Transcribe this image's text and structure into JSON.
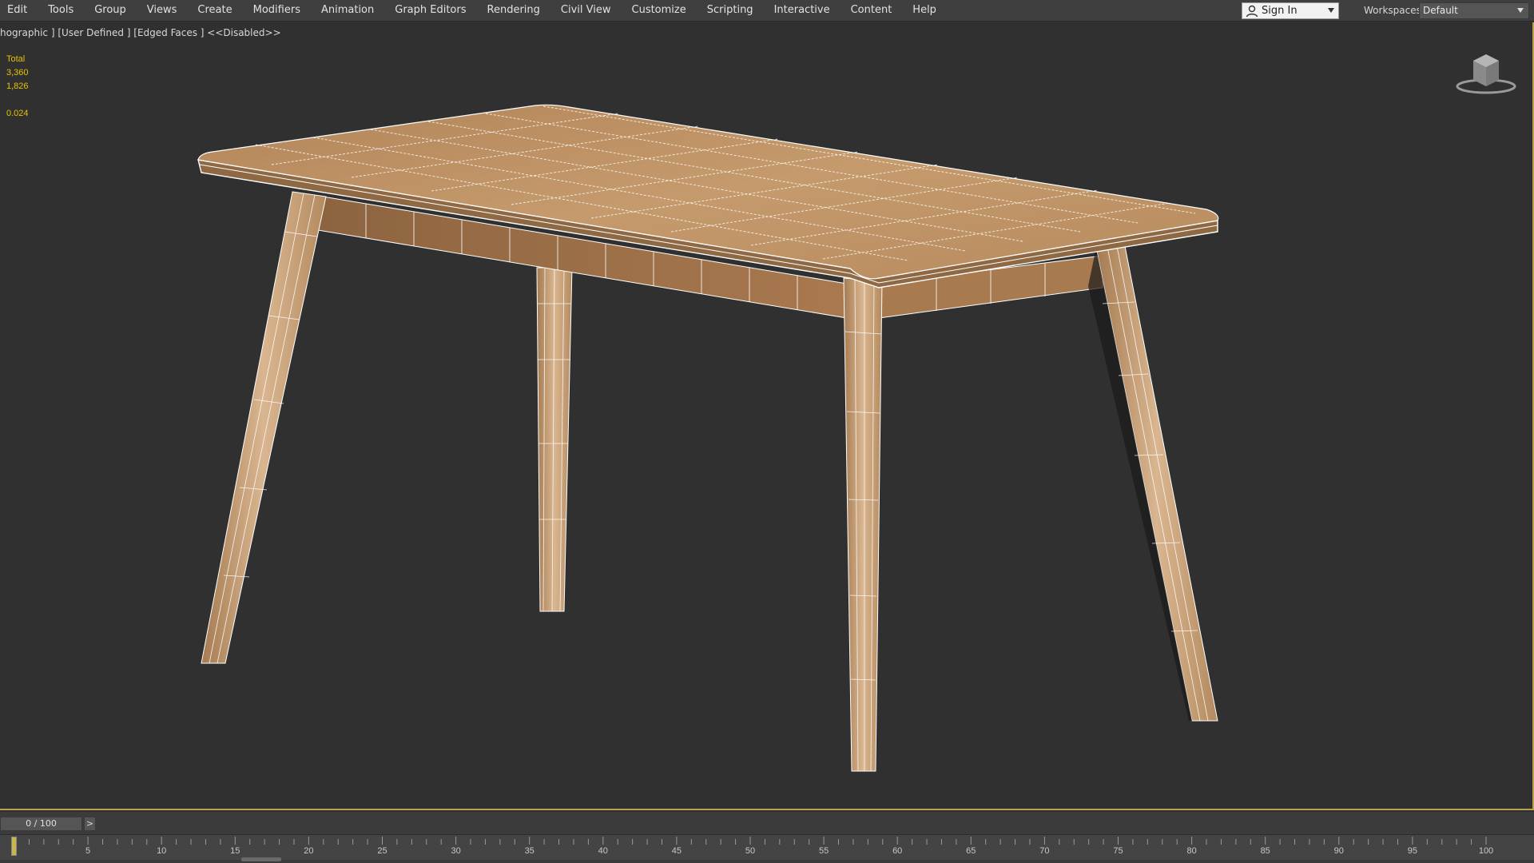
{
  "menu": {
    "items": [
      "Edit",
      "Tools",
      "Group",
      "Views",
      "Create",
      "Modifiers",
      "Animation",
      "Graph Editors",
      "Rendering",
      "Civil View",
      "Customize",
      "Scripting",
      "Interactive",
      "Content",
      "Help"
    ]
  },
  "account": {
    "sign_in_label": "Sign In"
  },
  "workspaces": {
    "label": "Workspaces:",
    "value": "Default"
  },
  "viewport": {
    "label": "hographic ] [User Defined ] [Edged Faces ]   <<Disabled>>",
    "stats": {
      "total_label": "Total",
      "polys": "3,360",
      "verts": "1,826",
      "fps": "0.024"
    },
    "active_border_color": "#b8a24a",
    "model": {
      "name": "wooden table",
      "wood_color": "#c39a6b",
      "wire_color": "#ffffff"
    }
  },
  "timeline": {
    "frame_display": "0 / 100",
    "next_label": ">",
    "current_frame": 0,
    "range": [
      0,
      100
    ],
    "tick_labels": [
      "5",
      "10",
      "15",
      "20",
      "25",
      "30",
      "35",
      "40",
      "45",
      "50",
      "55",
      "60",
      "65",
      "70",
      "75",
      "80",
      "85",
      "90",
      "95",
      "100"
    ]
  }
}
